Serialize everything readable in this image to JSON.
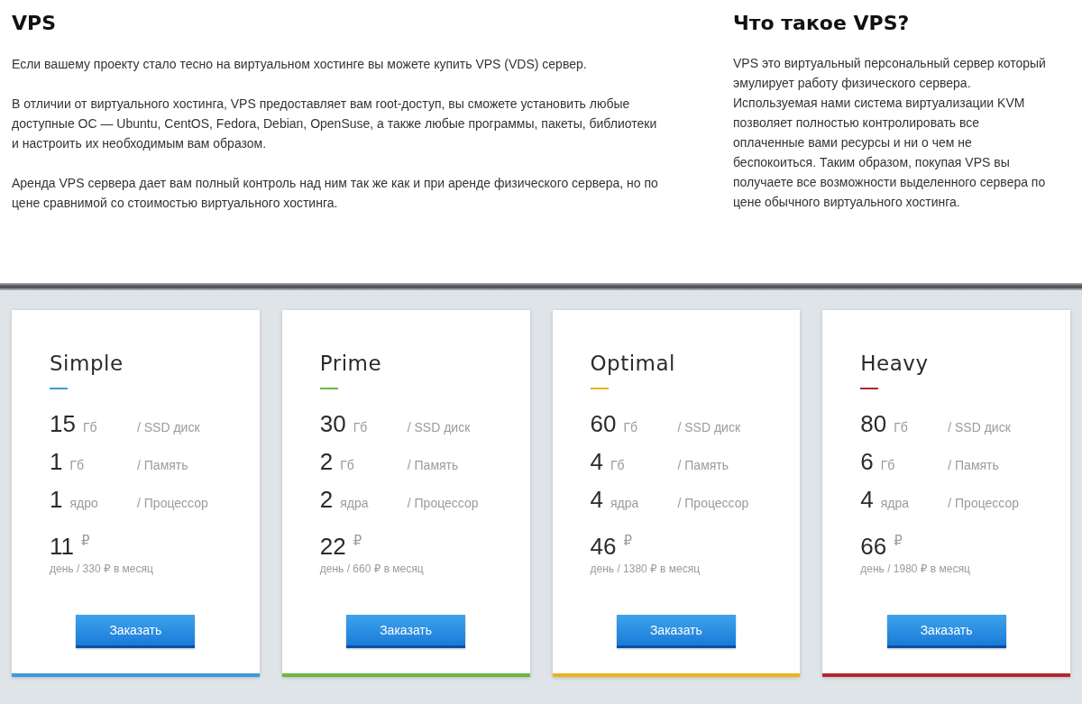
{
  "intro": {
    "title": "VPS",
    "paragraphs": [
      "Если вашему проекту стало тесно на виртуальном хостинге вы можете купить VPS (VDS) сервер.",
      "В отличии от виртуального хостинга, VPS предоставляет вам root-доступ, вы сможете установить любые доступные ОС — Ubuntu, CentOS, Fedora, Debian, OpenSuse, а также любые программы, пакеты, библиотеки и настроить их необходимым вам образом.",
      "Аренда VPS сервера дает вам полный контроль над ним так же как и при аренде физического сервера, но по цене сравнимой со стоимостью виртуального хостинга."
    ]
  },
  "about": {
    "title": "Что такое VPS?",
    "text": "VPS это виртуальный персональный сервер который эмулирует работу физического сервера. Используемая нами система виртуализации KVM позволяет полностью контролировать все оплаченные вами ресурсы и ни о чем не беспокоиться. Таким образом, покупая VPS вы получаете все возможности выделенного сервера по цене обычного виртуального хостинга."
  },
  "plans": [
    {
      "name": "Simple",
      "color": "#3d9ad8",
      "specs": [
        {
          "value": "15",
          "unit": "Гб",
          "label": "/ SSD диск"
        },
        {
          "value": "1",
          "unit": "Гб",
          "label": "/ Память"
        },
        {
          "value": "1",
          "unit": "ядро",
          "label": "/ Процессор"
        }
      ],
      "price": "11",
      "currency": "₽",
      "price_note": "день / 330 ₽ в месяц",
      "button": "Заказать"
    },
    {
      "name": "Prime",
      "color": "#6bb83c",
      "specs": [
        {
          "value": "30",
          "unit": "Гб",
          "label": "/ SSD диск"
        },
        {
          "value": "2",
          "unit": "Гб",
          "label": "/ Память"
        },
        {
          "value": "2",
          "unit": "ядра",
          "label": "/ Процессор"
        }
      ],
      "price": "22",
      "currency": "₽",
      "price_note": "день / 660 ₽ в месяц",
      "button": "Заказать"
    },
    {
      "name": "Optimal",
      "color": "#e5b420",
      "specs": [
        {
          "value": "60",
          "unit": "Гб",
          "label": "/ SSD диск"
        },
        {
          "value": "4",
          "unit": "Гб",
          "label": "/ Память"
        },
        {
          "value": "4",
          "unit": "ядра",
          "label": "/ Процессор"
        }
      ],
      "price": "46",
      "currency": "₽",
      "price_note": "день / 1380 ₽ в месяц",
      "button": "Заказать"
    },
    {
      "name": "Heavy",
      "color": "#b0282c",
      "specs": [
        {
          "value": "80",
          "unit": "Гб",
          "label": "/ SSD диск"
        },
        {
          "value": "6",
          "unit": "Гб",
          "label": "/ Память"
        },
        {
          "value": "4",
          "unit": "ядра",
          "label": "/ Процессор"
        }
      ],
      "price": "66",
      "currency": "₽",
      "price_note": "день / 1980 ₽ в месяц",
      "button": "Заказать"
    }
  ]
}
